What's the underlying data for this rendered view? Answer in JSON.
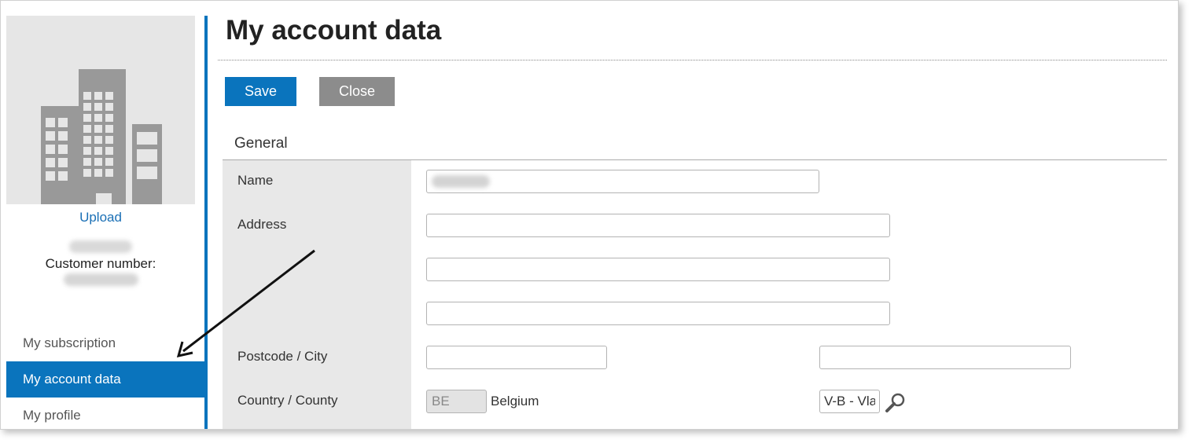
{
  "sidebar": {
    "upload_label": "Upload",
    "customer_number_label": "Customer number:",
    "nav": [
      {
        "label": "My subscription",
        "active": false
      },
      {
        "label": "My account data",
        "active": true
      },
      {
        "label": "My profile",
        "active": false
      }
    ]
  },
  "main": {
    "title": "My account data",
    "toolbar": {
      "save_label": "Save",
      "close_label": "Close"
    },
    "section_title": "General",
    "fields": {
      "name_label": "Name",
      "address_label": "Address",
      "postcode_city_label": "Postcode / City",
      "country_county_label": "Country / County",
      "country_code": "BE",
      "country_name": "Belgium",
      "county_value": "V-B - Vla"
    }
  },
  "icons": {
    "logo": "building-icon",
    "lookup": "search-icon",
    "annotation": "arrow-icon"
  },
  "colors": {
    "accent": "#0a74bd",
    "secondary_button": "#8c8c8c",
    "link": "#1a6fb5",
    "label_column": "#e8e8e8"
  }
}
